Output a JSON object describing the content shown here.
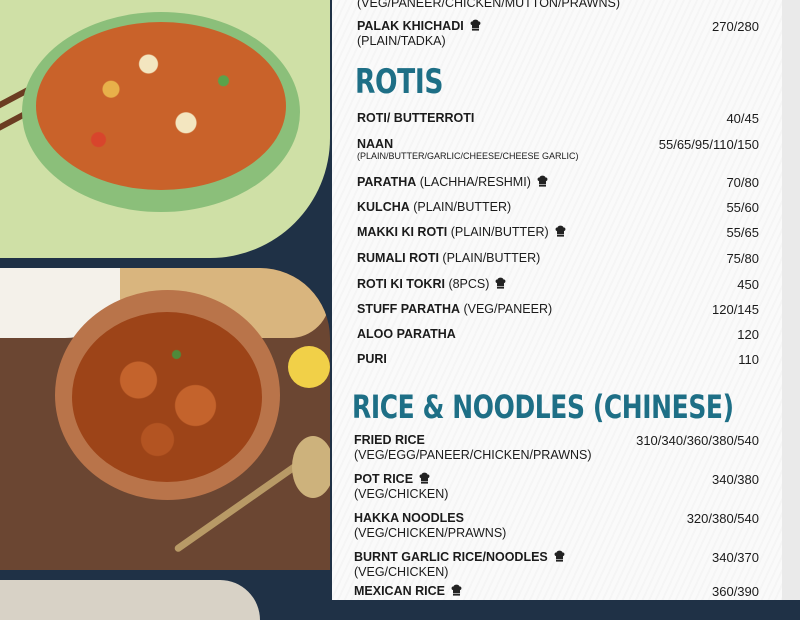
{
  "top_partial": {
    "prev_sub": "(VEG/PANEER/CHICKEN/MUTTON/PRAWNS)",
    "item": {
      "name": "PALAK KHICHADI",
      "sub": "(PLAIN/TADKA)",
      "price": "270/280",
      "chef": true
    }
  },
  "rotis": {
    "title": "ROTIS",
    "items": [
      {
        "name": "ROTI/ BUTTERROTI",
        "opt": "",
        "price": "40/45",
        "chef": false,
        "sub": ""
      },
      {
        "name": "NAAN",
        "opt": "",
        "price": "55/65/95/110/150",
        "chef": false,
        "sub": "(PLAIN/BUTTER/GARLIC/CHEESE/CHEESE GARLIC)"
      },
      {
        "name": "PARATHA",
        "opt": " (LACHHA/RESHMI)",
        "price": "70/80",
        "chef": true,
        "sub": ""
      },
      {
        "name": "KULCHA",
        "opt": " (PLAIN/BUTTER)",
        "price": "55/60",
        "chef": false,
        "sub": ""
      },
      {
        "name": "MAKKI KI ROTI",
        "opt": " (PLAIN/BUTTER)",
        "price": "55/65",
        "chef": true,
        "sub": ""
      },
      {
        "name": "RUMALI ROTI",
        "opt": " (PLAIN/BUTTER)",
        "price": "75/80",
        "chef": false,
        "sub": ""
      },
      {
        "name": "ROTI KI TOKRI",
        "opt": " (8PCS)",
        "price": "450",
        "chef": true,
        "sub": ""
      },
      {
        "name": "STUFF PARATHA",
        "opt": " (VEG/PANEER)",
        "price": "120/145",
        "chef": false,
        "sub": ""
      },
      {
        "name": "ALOO PARATHA",
        "opt": "",
        "price": "120",
        "chef": false,
        "sub": ""
      },
      {
        "name": "PURI",
        "opt": "",
        "price": "110",
        "chef": false,
        "sub": ""
      }
    ]
  },
  "rice": {
    "title": "RICE & NOODLES (CHINESE)",
    "items": [
      {
        "name": "FRIED RICE",
        "sub": "(VEG/EGG/PANEER/CHICKEN/PRAWNS)",
        "price": "310/340/360/380/540",
        "chef": false
      },
      {
        "name": "POT RICE",
        "sub": "(VEG/CHICKEN)",
        "price": "340/380",
        "chef": true
      },
      {
        "name": "HAKKA NOODLES",
        "sub": "(VEG/CHICKEN/PRAWNS)",
        "price": "320/380/540",
        "chef": false
      },
      {
        "name": "BURNT GARLIC RICE/NOODLES",
        "sub": "(VEG/CHICKEN)",
        "price": "340/370",
        "chef": true
      },
      {
        "name": "MEXICAN RICE",
        "sub": "",
        "price": "360/390",
        "chef": true
      }
    ]
  }
}
